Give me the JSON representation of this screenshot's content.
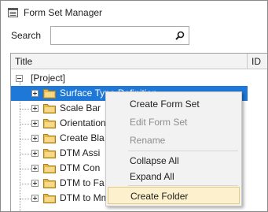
{
  "window": {
    "title": "Form Set Manager",
    "icon": "form-set-manager-icon"
  },
  "search": {
    "label": "Search",
    "value": "",
    "placeholder": "",
    "icon": "search-icon"
  },
  "grid": {
    "columns": [
      "Title",
      "ID"
    ],
    "rows": [
      {
        "label": "[Project]",
        "expander": "minus",
        "level": 0
      },
      {
        "label": "Surface Type Definition",
        "expander": "plus",
        "level": 1,
        "selected": true
      },
      {
        "label": "Scale Bar",
        "expander": "plus",
        "level": 1
      },
      {
        "label": "Orientation",
        "expander": "plus",
        "level": 1
      },
      {
        "label": "Create Bla",
        "expander": "plus",
        "level": 1
      },
      {
        "label": "DTM Assi",
        "expander": "plus",
        "level": 1
      },
      {
        "label": "DTM Con",
        "expander": "plus",
        "level": 1
      },
      {
        "label": "DTM to Fa",
        "expander": "plus",
        "level": 1
      },
      {
        "label": "DTM to Mm File",
        "expander": "plus",
        "level": 1
      }
    ]
  },
  "context_menu": {
    "items": [
      {
        "label": "Create Form Set",
        "enabled": true
      },
      {
        "label": "Edit Form Set",
        "enabled": false
      },
      {
        "label": "Rename",
        "enabled": false
      },
      {
        "label": "Collapse All",
        "enabled": true
      },
      {
        "label": "Expand All",
        "enabled": true
      },
      {
        "label": "Create Folder",
        "enabled": true,
        "highlighted": true
      }
    ]
  },
  "colors": {
    "selection": "#1e78d8",
    "menu_highlight": "#fcf1cc",
    "folder": "#e8b84a"
  }
}
